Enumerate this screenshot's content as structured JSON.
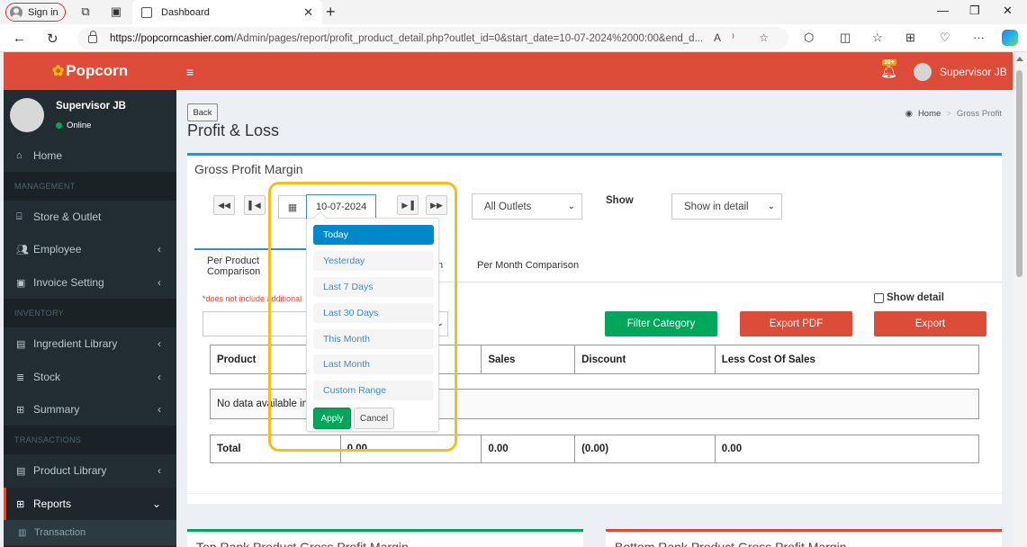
{
  "browser": {
    "signin_label": "Sign in",
    "tab_title": "Dashboard",
    "url_host": "https://popcorncashier.com",
    "url_path": "/Admin/pages/report/profit_product_detail.php?outlet_id=0&start_date=10-07-2024%2000:00&end_d...",
    "url_read_aloud": "A⁾",
    "toolbar_icons": [
      "favorites-star-icon",
      "extensions-icon",
      "split-screen-icon",
      "favorites-icon",
      "collections-icon",
      "browser-essentials-icon",
      "more-icon",
      "copilot-icon"
    ]
  },
  "app": {
    "logo": "Popcorn",
    "notif_badge": "10+",
    "user_name": "Supervisor JB",
    "user_status": "Online"
  },
  "sidebar": {
    "home": "Home",
    "header_management": "MANAGEMENT",
    "store_outlet": "Store & Outlet",
    "employee": "Employee",
    "invoice_setting": "Invoice Setting",
    "header_inventory": "INVENTORY",
    "ingredient_library": "Ingredient Library",
    "stock": "Stock",
    "summary": "Summary",
    "header_transactions": "TRANSACTIONS",
    "product_library": "Product Library",
    "reports": "Reports",
    "transaction": "Transaction"
  },
  "content": {
    "back_label": "Back",
    "page_title": "Profit & Loss",
    "breadcrumb_home": "Home",
    "breadcrumb_current": "Gross Profit",
    "box_title": "Gross Profit Margin",
    "date_value": "10-07-2024",
    "outlet_select": "All Outlets",
    "show_label": "Show",
    "show_select": "Show in detail",
    "tab_product": "Per Product Comparison",
    "tab_month": "Per Month Comparison",
    "tab_hidden_fragment": "n",
    "note": "*does not include additional",
    "show_detail_label": "Show detail",
    "filter_category": "Filter Category",
    "export_pdf": "Export PDF",
    "export": "Export",
    "filter_select_mid": "⌄",
    "table": {
      "headers": [
        "Product",
        "",
        "Sales",
        "Discount",
        "Less Cost Of Sales"
      ],
      "empty_text": "No data available in t",
      "empty_text_tail": "",
      "total_row": [
        "Total",
        "0.00",
        "0.00",
        "(0.00)",
        "0.00"
      ]
    },
    "bottom_left_title": "Top Rank Product Gross Profit Margin",
    "bottom_right_title": "Bottom Rank Product Gross Profit Margin"
  },
  "daterange": {
    "ranges": [
      "Today",
      "Yesterday",
      "Last 7 Days",
      "Last 30 Days",
      "This Month",
      "Last Month",
      "Custom Range"
    ],
    "active_index": 0,
    "apply_label": "Apply",
    "cancel_label": "Cancel"
  },
  "colors": {
    "header_red": "#dd4b39",
    "sidebar_dark": "#222d32",
    "accent_blue": "#3c8dbc",
    "green": "#00a65a",
    "highlight_yellow": "#f6be1d"
  }
}
